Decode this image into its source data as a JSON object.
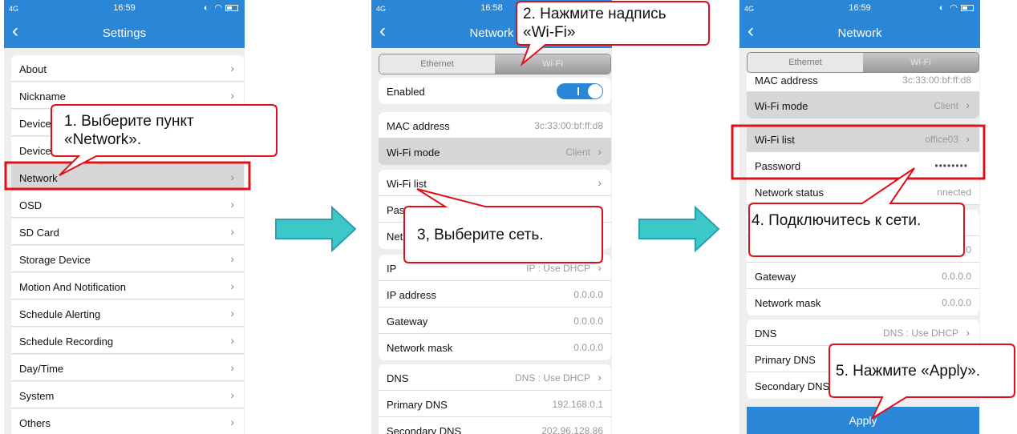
{
  "status": {
    "signal": "4G",
    "time1": "16:59",
    "time2": "16:58",
    "time3": "16:59"
  },
  "colors": {
    "accent": "#2a86d6",
    "callout_border": "#e0101a",
    "arrow": "#3cc7c9"
  },
  "phone1": {
    "back_icon": "‹",
    "title": "Settings",
    "items": [
      {
        "label": "About"
      },
      {
        "label": "Nickname"
      },
      {
        "label": "Device"
      },
      {
        "label": "Device"
      },
      {
        "label": "Network"
      },
      {
        "label": "OSD"
      },
      {
        "label": "SD Card"
      },
      {
        "label": "Storage Device"
      },
      {
        "label": "Motion And Notification"
      },
      {
        "label": "Schedule Alerting"
      },
      {
        "label": "Schedule Recording"
      },
      {
        "label": "Day/Time"
      },
      {
        "label": "System"
      },
      {
        "label": "Others"
      }
    ]
  },
  "phone2": {
    "title": "Network",
    "seg": {
      "ethernet": "Ethernet",
      "wifi": "Wi-Fi"
    },
    "enabled": "Enabled",
    "mac_label": "MAC address",
    "mac_value": "3c:33:00:bf:ff:d8",
    "wifi_mode_label": "Wi-Fi mode",
    "wifi_mode_value": "Client",
    "wifi_list": "Wi-Fi list",
    "password_partial": "Pas",
    "network_partial": "Net",
    "ip_label": "IP",
    "ip_value": "IP : Use DHCP",
    "ip_address_label": "IP address",
    "ip_address_value": "0.0.0.0",
    "gateway_label": "Gateway",
    "gateway_value": "0.0.0.0",
    "mask_label": "Network mask",
    "mask_value": "0.0.0.0",
    "dns_label": "DNS",
    "dns_value": "DNS : Use DHCP",
    "primary_dns_label": "Primary DNS",
    "primary_dns_value": "192.168.0.1",
    "secondary_dns_label": "Secondary DNS",
    "secondary_dns_value": "202.96.128.86"
  },
  "phone3": {
    "title": "Network",
    "seg": {
      "ethernet": "Ethernet",
      "wifi": "Wi-Fi"
    },
    "mac_label": "MAC address",
    "mac_value": "3c:33:00:bf:ff:d8",
    "wifi_mode_label": "Wi-Fi mode",
    "wifi_mode_value": "Client",
    "wifi_list_label": "Wi-Fi list",
    "wifi_list_value": "office03",
    "password_label": "Password",
    "password_value": "••••••••",
    "status_label": "Network status",
    "status_value": "nnected",
    "partial_value": "0",
    "gateway_label": "Gateway",
    "gateway_value": "0.0.0.0",
    "mask_label": "Network mask",
    "mask_value": "0.0.0.0",
    "dns_label": "DNS",
    "dns_value": "DNS : Use DHCP",
    "primary_dns_label": "Primary DNS",
    "secondary_dns_label": "Secondary DNS",
    "apply": "Apply"
  },
  "callouts": {
    "c1": "1. Выберите пункт\n«Network».",
    "c2": "2. Нажмите надпись\n«Wi-Fi»",
    "c3": "3, Выберите сеть.",
    "c4": "4. Подключитесь к сети.",
    "c5": "5. Нажмите «Apply»."
  },
  "chevron": "›"
}
